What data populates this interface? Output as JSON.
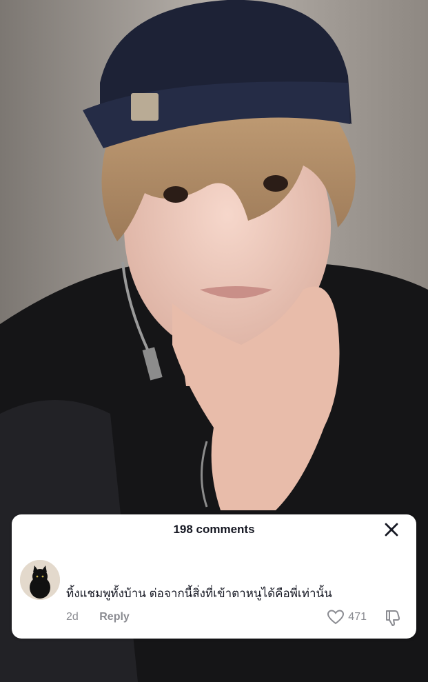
{
  "comments_panel": {
    "title": "198 comments",
    "close_icon": "close-icon"
  },
  "comment": {
    "avatar": "black-cat-avatar",
    "text": "ทิ้งแชมพูทั้งบ้าน ต่อจากนี้สิ่งที่เข้าตาหนูได้คือพี่เท่านั้น",
    "time": "2d",
    "reply_label": "Reply",
    "like_count": "471",
    "like_icon": "heart-icon",
    "dislike_icon": "dislike-icon"
  },
  "colors": {
    "card_background": "#ffffff",
    "primary_text": "#161823",
    "secondary_text": "#8a8b91"
  }
}
